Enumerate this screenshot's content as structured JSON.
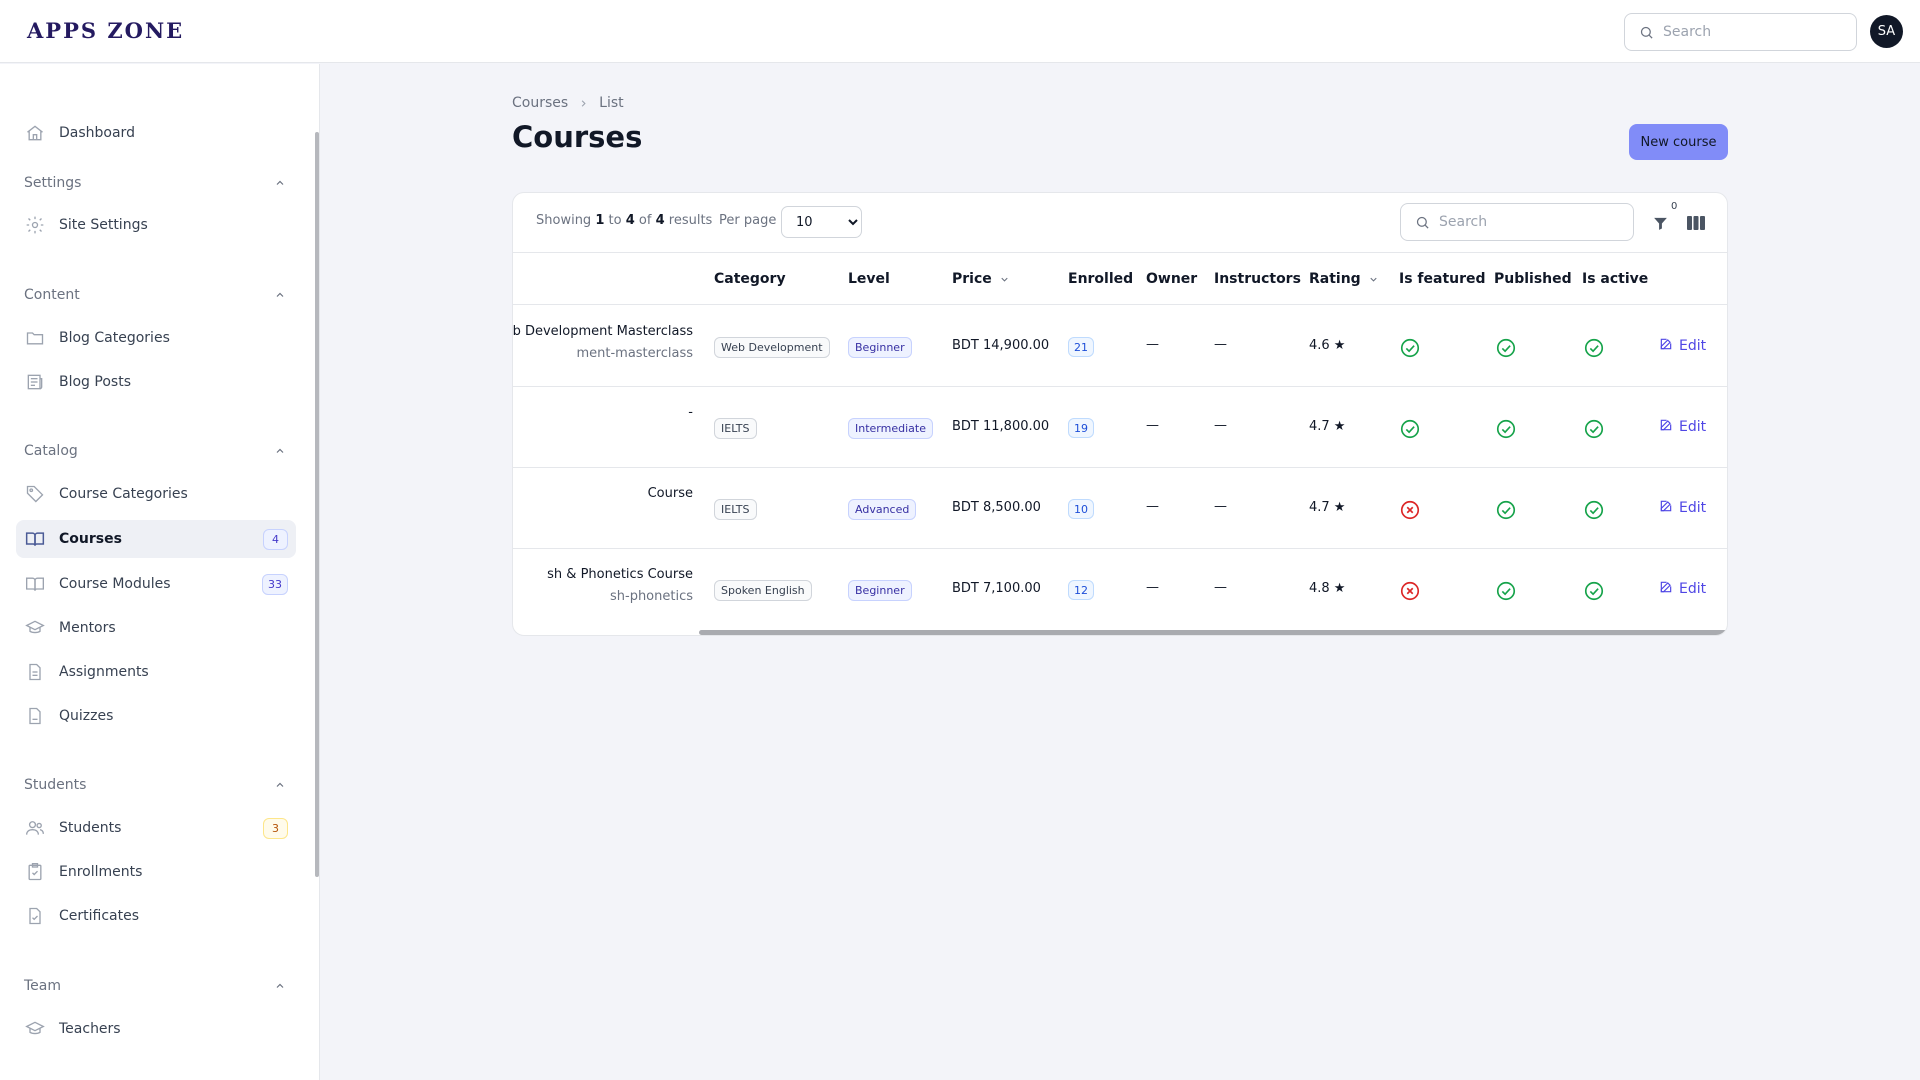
{
  "app": {
    "logo": "APPS ZONE",
    "search_placeholder": "Search",
    "avatar_initials": "SA"
  },
  "sidebar": {
    "dashboard": "Dashboard",
    "groups": {
      "settings": "Settings",
      "content": "Content",
      "catalog": "Catalog",
      "students": "Students",
      "team": "Team"
    },
    "items": {
      "site_settings": "Site Settings",
      "blog_categories": "Blog Categories",
      "blog_posts": "Blog Posts",
      "course_categories": "Course Categories",
      "courses": "Courses",
      "courses_badge": "4",
      "course_modules": "Course Modules",
      "course_modules_badge": "33",
      "mentors": "Mentors",
      "assignments": "Assignments",
      "quizzes": "Quizzes",
      "students": "Students",
      "students_badge": "3",
      "enrollments": "Enrollments",
      "certificates": "Certificates",
      "teachers": "Teachers"
    }
  },
  "page": {
    "breadcrumb": [
      "Courses",
      "List"
    ],
    "title": "Courses",
    "new_button": "New course"
  },
  "table": {
    "showing_prefix": "Showing",
    "from": "1",
    "to_word": "to",
    "to": "4",
    "of_word": "of",
    "total": "4",
    "results_word": "results",
    "per_page_label": "Per page",
    "per_page_value": "10",
    "search_placeholder": "Search",
    "filter_count": "0",
    "columns": {
      "category": "Category",
      "level": "Level",
      "price": "Price",
      "enrolled": "Enrolled",
      "owner": "Owner",
      "instructors": "Instructors",
      "rating": "Rating",
      "is_featured": "Is featured",
      "published": "Published",
      "is_active": "Is active"
    },
    "edit_label": "Edit",
    "rows": [
      {
        "title": "eb Development Masterclass",
        "slug": "ment-masterclass",
        "category": "Web Development",
        "level": "Beginner",
        "price": "BDT 14,900.00",
        "enrolled": "21",
        "owner": "—",
        "instructors": "—",
        "rating": "4.6 ★",
        "featured": true,
        "published": true,
        "active": true
      },
      {
        "title": "-",
        "slug": "",
        "category": "IELTS",
        "level": "Intermediate",
        "price": "BDT 11,800.00",
        "enrolled": "19",
        "owner": "—",
        "instructors": "—",
        "rating": "4.7 ★",
        "featured": true,
        "published": true,
        "active": true
      },
      {
        "title": "Course",
        "slug": "",
        "category": "IELTS",
        "level": "Advanced",
        "price": "BDT 8,500.00",
        "enrolled": "10",
        "owner": "—",
        "instructors": "—",
        "rating": "4.7 ★",
        "featured": false,
        "published": true,
        "active": true
      },
      {
        "title": "sh & Phonetics Course",
        "slug": "sh-phonetics",
        "category": "Spoken English",
        "level": "Beginner",
        "price": "BDT 7,100.00",
        "enrolled": "12",
        "owner": "—",
        "instructors": "—",
        "rating": "4.8 ★",
        "featured": false,
        "published": true,
        "active": true
      }
    ]
  },
  "colors": {
    "accent": "#818cf8",
    "success": "#16a34a",
    "danger": "#dc2626",
    "link": "#4f46e5"
  }
}
